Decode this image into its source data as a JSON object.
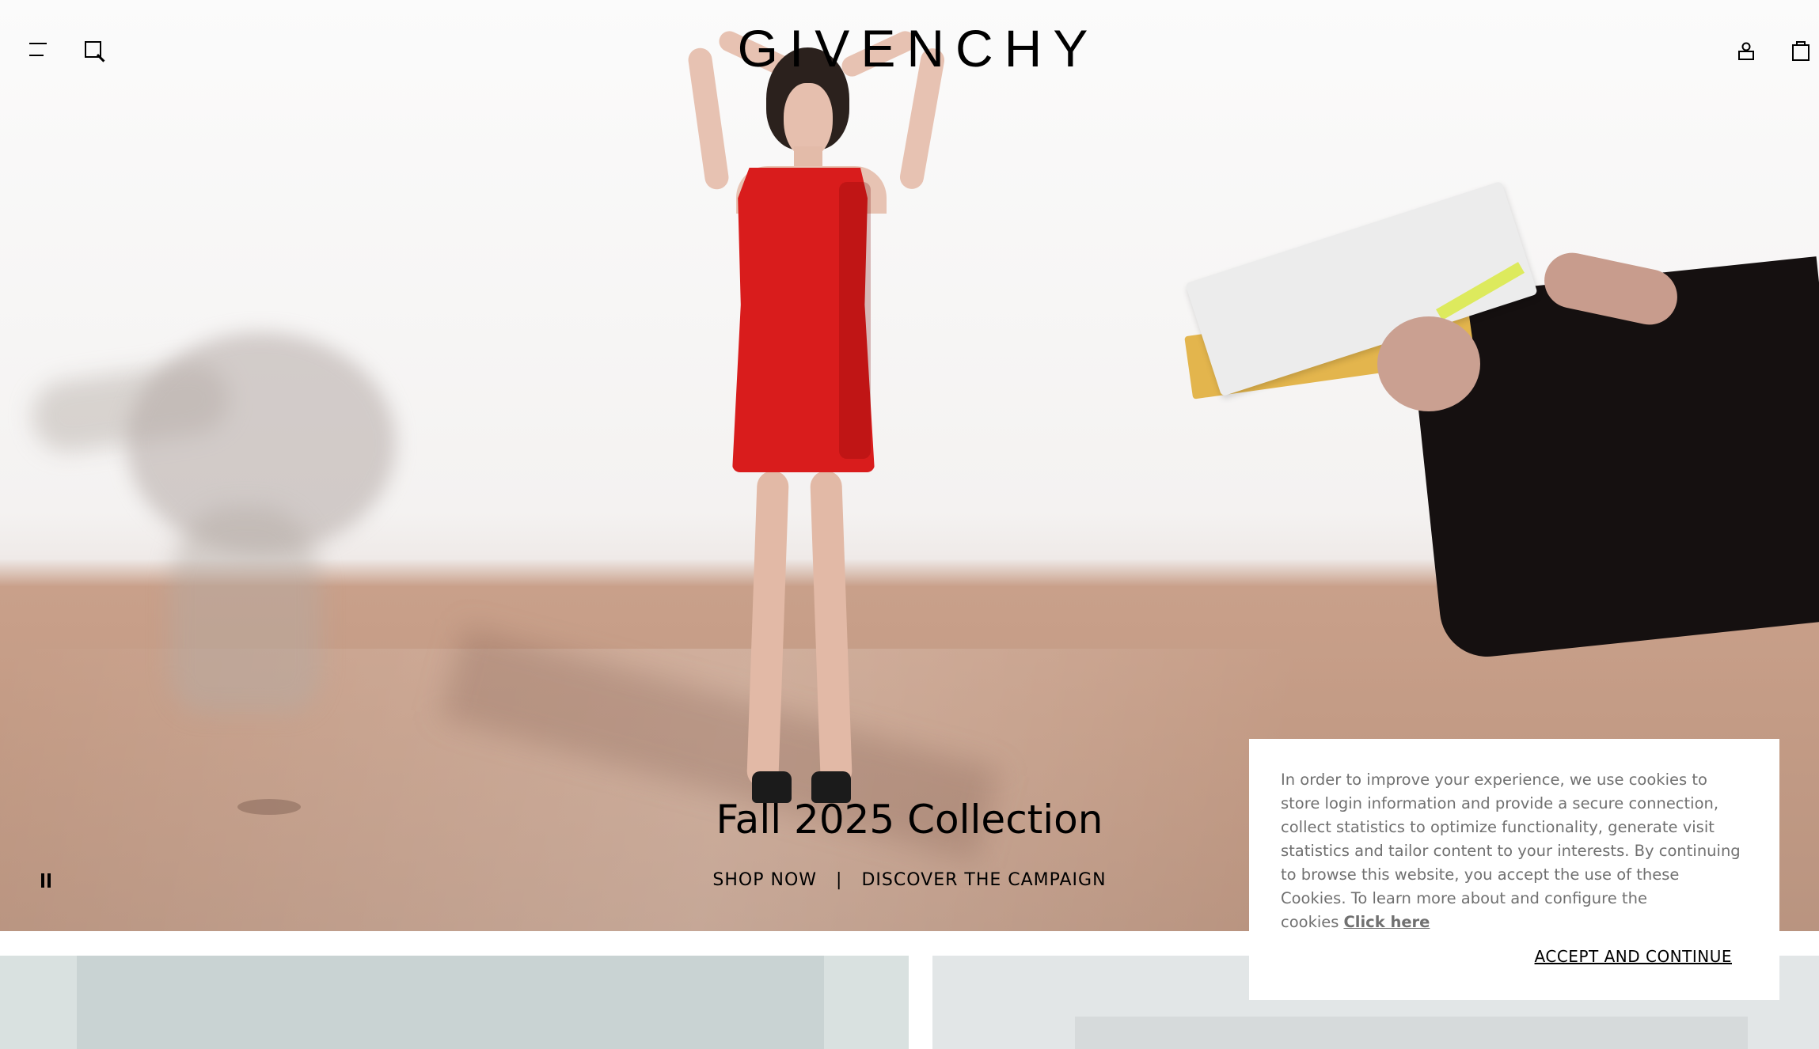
{
  "header": {
    "logo": "GIVENCHY",
    "icons": [
      "menu-icon",
      "search-icon",
      "account-icon",
      "shopping-bag-icon"
    ]
  },
  "hero": {
    "title": "Fall 2025 Collection",
    "links": {
      "shop_now": "SHOP NOW",
      "separator": "|",
      "discover": "DISCOVER THE CAMPAIGN"
    },
    "video_control_icon": "pause-icon"
  },
  "cookie_banner": {
    "text": "In order to improve your experience, we use cookies to store login information and provide a secure connection, collect statistics to optimize functionality, generate visit statistics and tailor content to your interests. By continuing to browse this website, you accept the use of these Cookies. To learn more about and configure the cookies",
    "link_label": "Click here",
    "accept_label": "ACCEPT AND CONTINUE"
  },
  "colors": {
    "dress": "#d91c1c",
    "text": "#000000",
    "cookie_text": "#707070"
  }
}
